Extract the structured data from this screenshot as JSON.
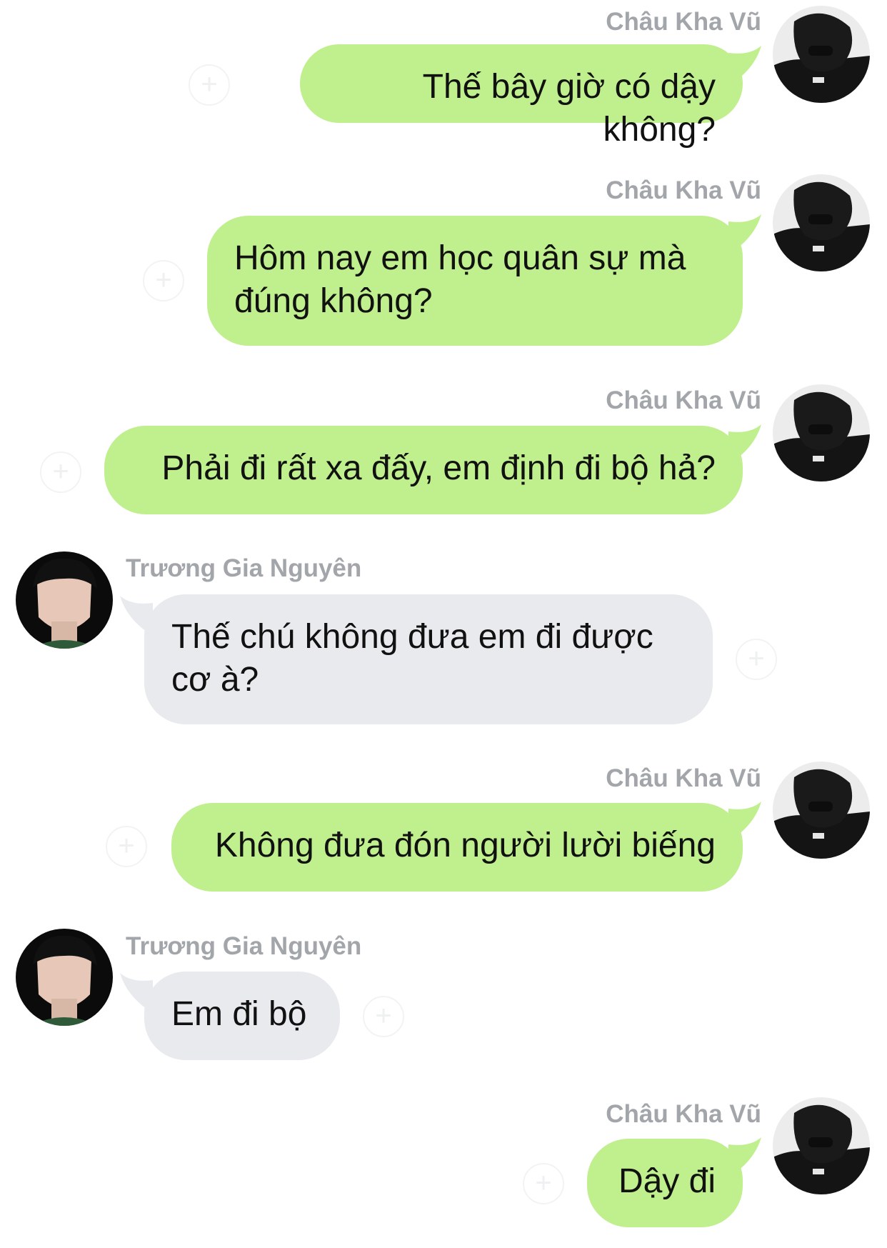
{
  "colors": {
    "outgoing_bubble": "#c0ef8e",
    "incoming_bubble": "#e8eaed",
    "name_text": "#a2a5a9",
    "message_text": "#111111"
  },
  "messages": [
    {
      "direction": "outgoing",
      "sender": "Châu Kha Vũ",
      "text": "Thế bây giờ có dậy không?"
    },
    {
      "direction": "outgoing",
      "sender": "Châu Kha Vũ",
      "text": "Hôm nay em học quân sự mà đúng không?"
    },
    {
      "direction": "outgoing",
      "sender": "Châu Kha Vũ",
      "text": "Phải đi rất xa đấy, em định đi bộ hả?"
    },
    {
      "direction": "incoming",
      "sender": "Trương Gia Nguyên",
      "text": "Thế chú không đưa em đi được cơ à?"
    },
    {
      "direction": "outgoing",
      "sender": "Châu Kha Vũ",
      "text": "Không đưa đón người lười biếng"
    },
    {
      "direction": "incoming",
      "sender": "Trương Gia Nguyên",
      "text": "Em đi bộ"
    },
    {
      "direction": "outgoing",
      "sender": "Châu Kha Vũ",
      "text": "Dậy đi"
    }
  ],
  "icons": {
    "reaction": "plus-circle-icon",
    "avatar_outgoing": "avatar-chau-kha-vu",
    "avatar_incoming": "avatar-truong-gia-nguyen"
  },
  "reaction_glyph": "+"
}
